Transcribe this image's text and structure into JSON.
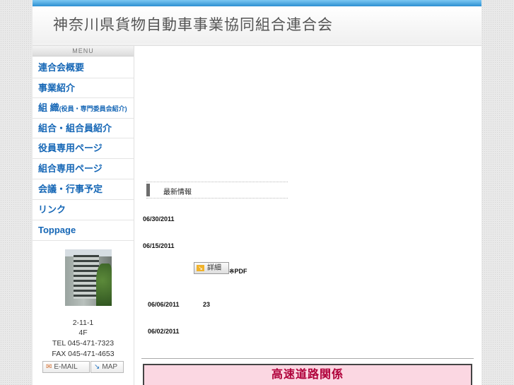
{
  "header": {
    "title": "神奈川県貨物自動車事業協同組合連合会"
  },
  "sidebar": {
    "menu_label": "MENU",
    "items": [
      {
        "label": "連合会概要"
      },
      {
        "label": "事業紹介"
      },
      {
        "label": "組 織",
        "sub": "(役員・専門委員会紹介)"
      },
      {
        "label": "組合・組合員紹介"
      },
      {
        "label": "役員専用ページ"
      },
      {
        "label": "組合専用ページ"
      },
      {
        "label": "会議・行事予定"
      },
      {
        "label": "リンク"
      },
      {
        "label": "Toppage"
      }
    ],
    "address_line1": "2-11-1",
    "address_line2": "4F",
    "tel": "TEL 045-471-7323",
    "fax": "FAX 045-471-4653",
    "email_label": "E-MAIL",
    "map_label": "MAP"
  },
  "news": {
    "heading": "最新情報",
    "items": [
      {
        "date": "06/30/2011"
      },
      {
        "date": "06/15/2011",
        "detail_label": "詳細",
        "pdf_label": "※PDF"
      },
      {
        "date": "06/06/2011",
        "note": "23"
      },
      {
        "date": "06/02/2011"
      }
    ]
  },
  "banner": {
    "label": "高速道路関係"
  },
  "colors": {
    "accent": "#1667b6",
    "topbar": "#2c8fd2",
    "banner_bg": "#fbd7e2",
    "banner_text": "#b0003a"
  }
}
